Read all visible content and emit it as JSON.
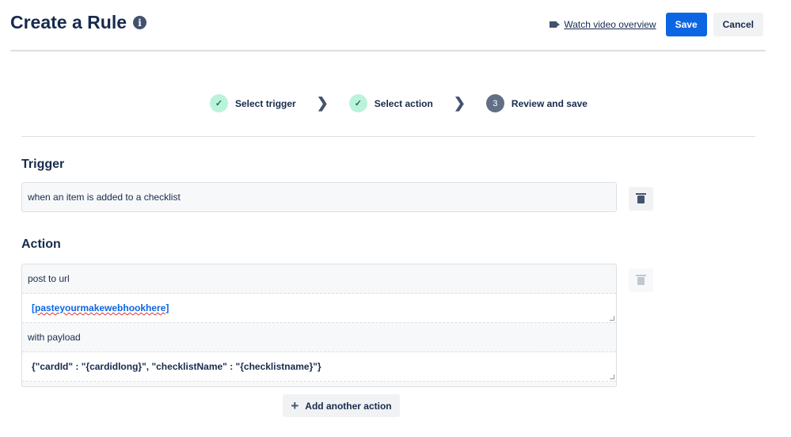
{
  "header": {
    "title": "Create a Rule",
    "info_icon": "i",
    "video_link": "Watch video overview",
    "save_label": "Save",
    "cancel_label": "Cancel"
  },
  "stepper": {
    "steps": [
      {
        "label": "Select trigger",
        "marker": "✓"
      },
      {
        "label": "Select action",
        "marker": "✓"
      },
      {
        "label": "Review and save",
        "marker": "3"
      }
    ],
    "separator": "❯"
  },
  "trigger": {
    "heading": "Trigger",
    "text": "when an item is added to a checklist"
  },
  "action": {
    "heading": "Action",
    "label_url": "post to url",
    "url_value": "[pasteyourmakewebhookhere]",
    "label_payload": "with payload",
    "payload_value": "{\"cardId\" : \"{cardidlong}\", \"checklistName\" : \"{checklistname}\"}"
  },
  "add_action": {
    "icon": "+",
    "label": "Add another action"
  }
}
